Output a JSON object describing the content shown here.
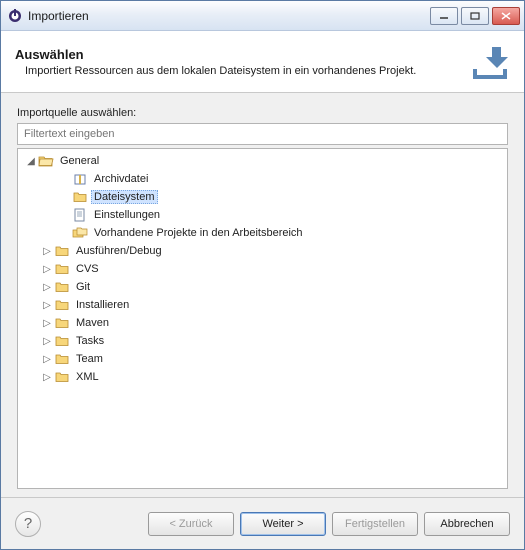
{
  "titlebar": {
    "title": "Importieren"
  },
  "banner": {
    "title": "Auswählen",
    "desc": "Importiert Ressourcen aus dem lokalen Dateisystem in ein vorhandenes Projekt."
  },
  "content": {
    "source_label": "Importquelle auswählen:",
    "filter_placeholder": "Filtertext eingeben"
  },
  "tree": {
    "general": {
      "label": "General",
      "children": {
        "archive": "Archivdatei",
        "filesystem": "Dateisystem",
        "preferences": "Einstellungen",
        "existing": "Vorhandene Projekte in den Arbeitsbereich"
      }
    },
    "run": "Ausführen/Debug",
    "cvs": "CVS",
    "git": "Git",
    "install": "Installieren",
    "maven": "Maven",
    "tasks": "Tasks",
    "team": "Team",
    "xml": "XML"
  },
  "footer": {
    "back": "< Zurück",
    "next": "Weiter >",
    "finish": "Fertigstellen",
    "cancel": "Abbrechen"
  },
  "icons": {
    "folder_fill": "#f7d67a",
    "folder_stroke": "#b78a2e"
  }
}
